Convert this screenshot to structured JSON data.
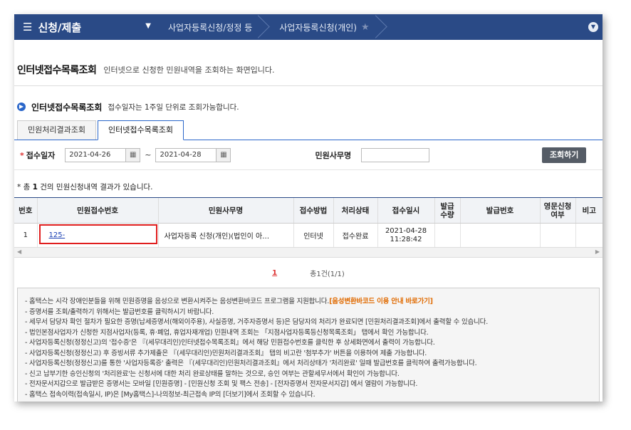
{
  "nav": {
    "menu": "신청/제출",
    "crumbs": [
      "사업자등록신청/정정 등",
      "사업자등록신청(개인)"
    ]
  },
  "page": {
    "title": "인터넷접수목록조회",
    "desc": "인터넷으로 신청한 민원내역을 조회하는 화면입니다."
  },
  "section": {
    "title": "인터넷접수목록조회",
    "note": "접수일자는 1주일 단위로 조회가능합니다."
  },
  "tabs": [
    "민원처리결과조회",
    "인터넷접수목록조회"
  ],
  "search": {
    "date_label": "접수일자",
    "from": "2021-04-26",
    "tilde": "~",
    "to": "2021-04-28",
    "service_label": "민원사무명",
    "button": "조회하기"
  },
  "result": {
    "prefix": "* 총",
    "count": "1",
    "suffix": "건의 민원신청내역 결과가 있습니다."
  },
  "table": {
    "headers": [
      "번호",
      "민원접수번호",
      "민원사무명",
      "접수방법",
      "처리상태",
      "접수일시",
      "발급\n수량",
      "발급번호",
      "영문신청\n여부",
      "비고"
    ],
    "rows": [
      {
        "no": "1",
        "receipt": "125-",
        "service": "사업자등록 신청(개인)(법인이 아…",
        "method": "인터넷",
        "status": "접수완료",
        "date": "2021-04-28",
        "time": "11:28:42"
      }
    ]
  },
  "pager": {
    "page": "1",
    "total": "총1건(1/1)"
  },
  "notice": {
    "items": [
      "- 홈택스는 시각 장애인분들을 위해 민원증명을 음성으로 변환시켜주는 음성변환바코드 프로그램을 지원합니다.",
      "- 증명서를 조회/출력하기 위해서는 발급번호를 클릭하시기 바랍니다.",
      "- 세무서 담당자 확인 절차가 필요한 증명(납세증명서(해외이주용), 사실증명, 거주자증명서 등)은 담당자의 처리가 완료되면 [민원처리결과조회]에서 출력할 수 있습니다.",
      "- 법인본점사업자가 신청한 지점사업자(등록, 휴·폐업, 휴업자재개업) 민원내역 조회는 「지점사업자등록등신청목록조회」 탭에서 확인 가능합니다.",
      "- 사업자등록신청(정정신고)의 '접수증'은 『(세무대리인)인터넷접수목록조회』에서 해당 민원접수번호를 클릭한 후 상세화면에서 출력이 가능합니다.",
      "- 사업자등록신청(정정신고) 후 증빙서류 추가제출은 『(세무대리인)민원처리결과조회』 탭의 비고란 '첨부추가' 버튼을 이용하여 제출 가능합니다.",
      "- 사업자등록신청(정정신고)를 통한 '사업자등록증' 출력은 『(세무대리인)민원처리결과조회』에서 처리상태가 '처리완료' 일때 발급번호를 클릭하여 출력가능합니다.",
      "- 신고 납부기한 승인신청의 '처리완료'는 신청서에 대한 처리 완료상태를 말하는 것으로, 승인 여부는 관할세무서에서 확인이 가능합니다.",
      "- 전자문서지갑으로 발급받은 증명서는 모바일 [민원증명] - [민원신청 조회 및 팩스 전송] - [전자증명서 전자문서지갑] 에서 열람이 가능합니다.",
      "- 홈택스 접속이력(접속일시, IP)은 [My홈택스]-나의정보-최근접속 IP의 [더보기]에서 조회할 수 있습니다."
    ],
    "link": "[음성변환바코드 이용 안내 바로가기]"
  }
}
